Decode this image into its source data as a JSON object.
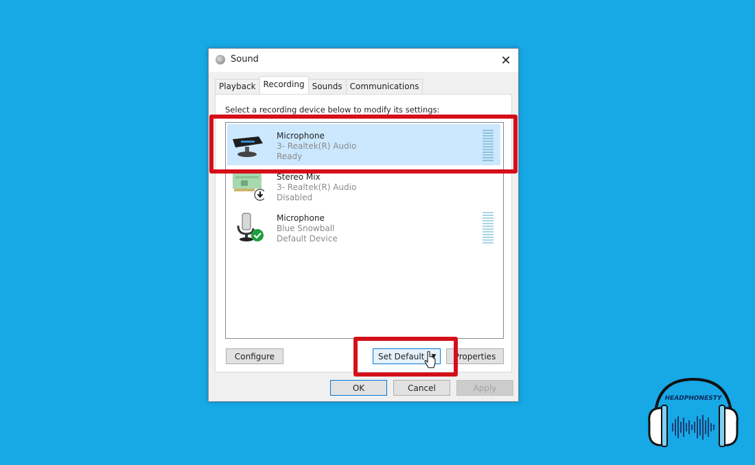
{
  "window": {
    "title": "Sound",
    "title_icon": "speaker-icon",
    "close_icon": "close-icon",
    "close_glyph": "✕"
  },
  "tabs": [
    {
      "label": "Playback",
      "active": false
    },
    {
      "label": "Recording",
      "active": true
    },
    {
      "label": "Sounds",
      "active": false
    },
    {
      "label": "Communications",
      "active": false
    }
  ],
  "panel": {
    "instruction": "Select a recording device below to modify its settings:"
  },
  "devices": [
    {
      "name": "Microphone",
      "driver": "3- Realtek(R) Audio",
      "status": "Ready",
      "icon": "webcam-microphone-icon",
      "selected": true,
      "highlighted": true,
      "has_meter": true
    },
    {
      "name": "Stereo Mix",
      "driver": "3- Realtek(R) Audio",
      "status": "Disabled",
      "icon": "sound-card-icon",
      "badge": "down-arrow-icon",
      "selected": false,
      "has_meter": false
    },
    {
      "name": "Microphone",
      "driver": "Blue Snowball",
      "status": "Default Device",
      "icon": "usb-microphone-icon",
      "badge": "green-check-icon",
      "selected": false,
      "has_meter": true
    }
  ],
  "buttons": {
    "configure": "Configure",
    "set_default": "Set Default",
    "set_default_arrow": "▼",
    "properties": "Properties",
    "properties_visible": "roperties",
    "ok": "OK",
    "cancel": "Cancel",
    "apply": "Apply"
  },
  "watermark": {
    "brand": "HEADPHONESTY"
  },
  "colors": {
    "desktop_bg": "#17a8e6",
    "selection": "#cce8ff",
    "highlight_box": "#d50f1a",
    "focus_border": "#0078d7"
  }
}
